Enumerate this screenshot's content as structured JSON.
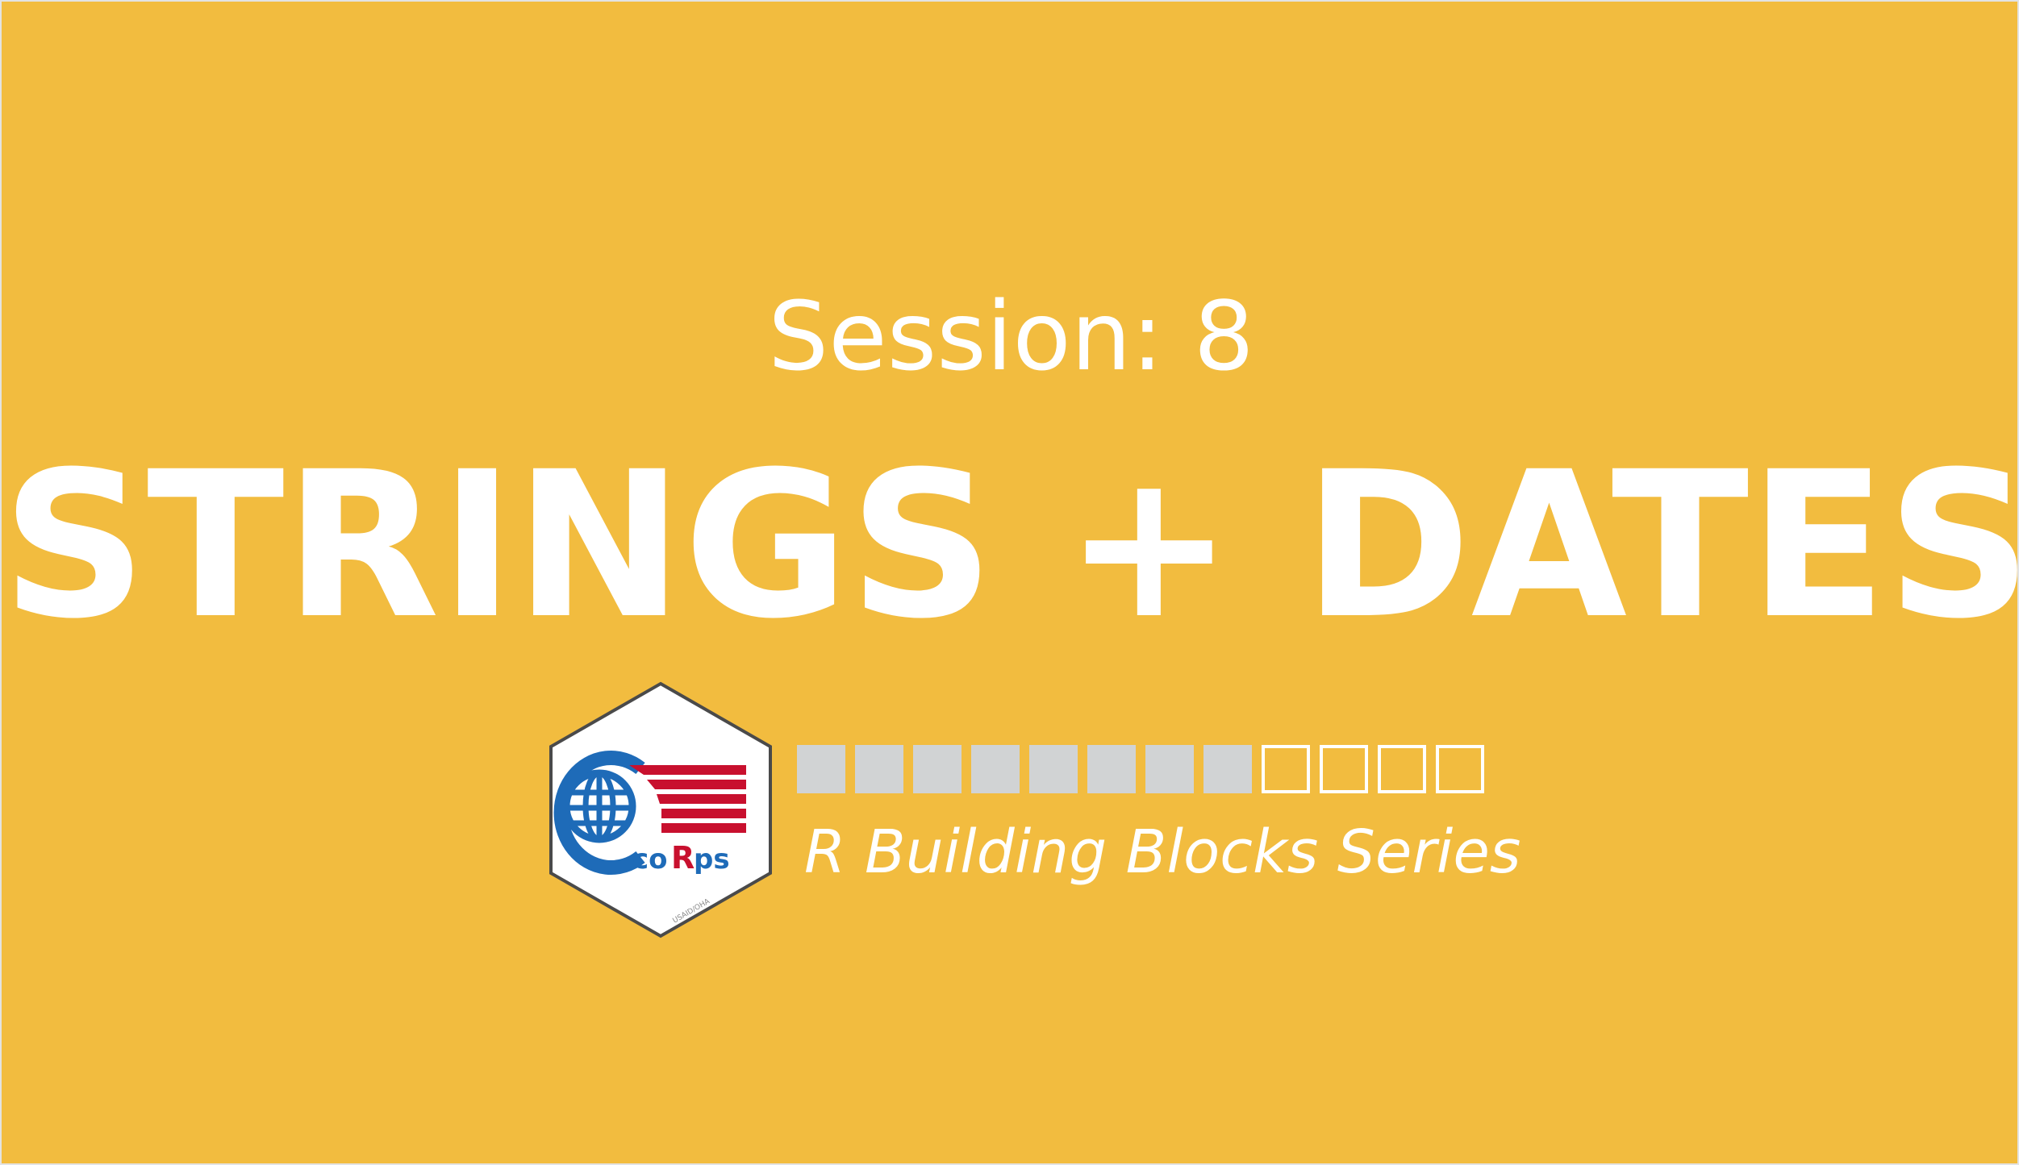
{
  "colors": {
    "background": "#F2BC3F",
    "text": "#FFFFFF",
    "block_complete": "#D1D3D4",
    "block_outline": "#FFFFFF",
    "logo_blue": "#1E6BB8",
    "logo_red": "#C8102E"
  },
  "session_label": "Session: 8",
  "title": "STRINGS + DATES",
  "progress": {
    "completed_sessions": 8,
    "total_sessions": 12
  },
  "series_name": "R Building Blocks Series",
  "logo": {
    "icon": "globe-with-flag-stripes-icon",
    "wordmark": "coRps",
    "small_print": "USAID/OHA"
  }
}
